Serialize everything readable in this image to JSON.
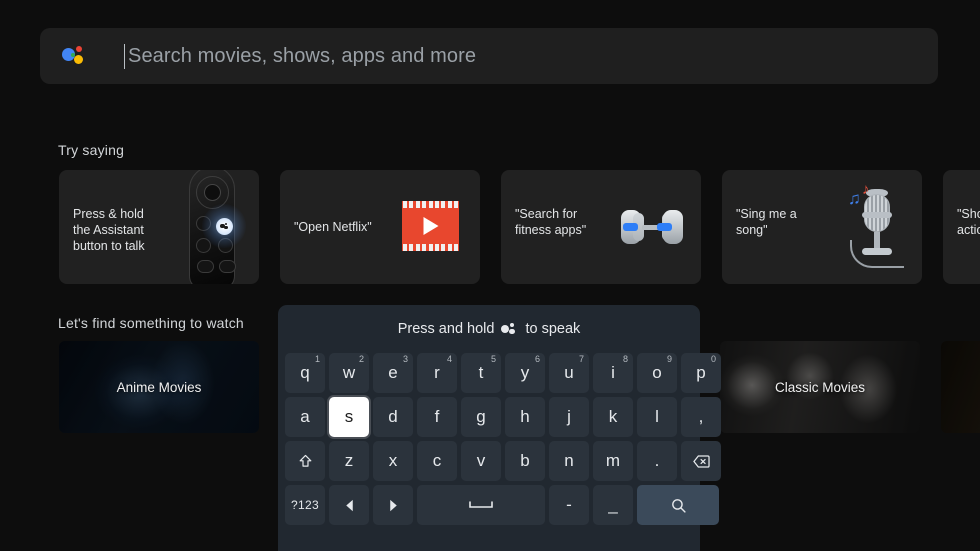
{
  "app": {
    "background_color": "#0d0d0d",
    "accent_color": "#3b4a5a"
  },
  "search": {
    "placeholder": "Search movies, shows, apps and more",
    "value": "",
    "assistant_icon": "google-assistant-icon"
  },
  "try_saying": {
    "label": "Try saying",
    "cards": [
      {
        "text": "Press & hold\nthe Assistant\nbutton to talk",
        "art": "tv-remote-icon"
      },
      {
        "text": "\"Open Netflix\"",
        "art": "film-strip-icon"
      },
      {
        "text": "\"Search for\nfitness apps\"",
        "art": "dumbbell-icon"
      },
      {
        "text": "\"Sing me a\nsong\"",
        "art": "microphone-icon"
      },
      {
        "text": "\"Show me\naction movies\"",
        "art": "action-movies-icon"
      }
    ]
  },
  "watch": {
    "label": "Let's find something to watch",
    "cards": [
      {
        "title": "Anime Movies"
      },
      {
        "title": "Classic Movies"
      },
      {
        "title": ""
      }
    ]
  },
  "keyboard": {
    "hint_prefix": "Press and hold",
    "hint_icon": "google-assistant-icon",
    "hint_suffix": "to speak",
    "selected_key": "s",
    "rows": [
      [
        {
          "label": "q",
          "sup": "1"
        },
        {
          "label": "w",
          "sup": "2"
        },
        {
          "label": "e",
          "sup": "3"
        },
        {
          "label": "r",
          "sup": "4"
        },
        {
          "label": "t",
          "sup": "5"
        },
        {
          "label": "y",
          "sup": "6"
        },
        {
          "label": "u",
          "sup": "7"
        },
        {
          "label": "i",
          "sup": "8"
        },
        {
          "label": "o",
          "sup": "9"
        },
        {
          "label": "p",
          "sup": "0"
        }
      ],
      [
        {
          "label": "a"
        },
        {
          "label": "s"
        },
        {
          "label": "d"
        },
        {
          "label": "f"
        },
        {
          "label": "g"
        },
        {
          "label": "h"
        },
        {
          "label": "j"
        },
        {
          "label": "k"
        },
        {
          "label": "l"
        },
        {
          "label": ","
        }
      ],
      [
        {
          "label": "",
          "icon": "shift-icon",
          "name": "shift-key"
        },
        {
          "label": "z"
        },
        {
          "label": "x"
        },
        {
          "label": "c"
        },
        {
          "label": "v"
        },
        {
          "label": "b"
        },
        {
          "label": "n"
        },
        {
          "label": "m"
        },
        {
          "label": "."
        },
        {
          "label": "",
          "icon": "backspace-icon",
          "name": "backspace-key"
        }
      ],
      [
        {
          "label": "?123",
          "name": "symbols-key"
        },
        {
          "label": "",
          "icon": "arrow-left-icon",
          "name": "cursor-left-key"
        },
        {
          "label": "",
          "icon": "arrow-right-icon",
          "name": "cursor-right-key"
        },
        {
          "label": "",
          "icon": "space-icon",
          "name": "space-key"
        },
        {
          "label": "-",
          "name": "hyphen-key"
        },
        {
          "label": "_",
          "name": "underscore-key"
        },
        {
          "label": "",
          "icon": "search-icon",
          "name": "search-submit-key"
        }
      ]
    ]
  }
}
